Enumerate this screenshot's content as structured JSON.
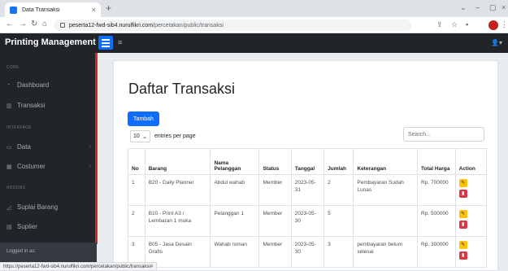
{
  "browser": {
    "tab_title": "Data Transaksi",
    "tab_close": "×",
    "new_tab": "+",
    "url_host": "peserta12-fwd-sib4.nurulfikri.com",
    "url_path": "/percetakan/public/transaksi",
    "status_url": "https://peserta12-fwd-sib4.nurulfikri.com/percetakan/public/transaksi#"
  },
  "topnav": {
    "brand": "Printing Management"
  },
  "sidebar": {
    "core_heading": "CORE",
    "dashboard": "Dashboard",
    "transaksi": "Transaksi",
    "interface_heading": "INTERFACE",
    "data": "Data",
    "costumer": "Costumer",
    "addons_heading": "ADDONS",
    "suplai": "Suplai Barang",
    "suplier": "Suplier",
    "footer_label": "Logged in as:"
  },
  "main": {
    "title": "Daftar Transaksi",
    "add_button": "Tambah",
    "page_length": "10",
    "entries_label": "entries per page",
    "search_placeholder": "Search...",
    "columns": [
      "No",
      "Barang",
      "Nama Pelanggan",
      "Status",
      "Tanggal",
      "Jumlah",
      "Keterangan",
      "Total Harga",
      "Action"
    ],
    "rows": [
      {
        "no": "1",
        "barang": "B20 - Daily Planner",
        "pelanggan": "Abdul wahab",
        "status": "Member",
        "tanggal": "2023-05-31",
        "jumlah": "2",
        "keterangan": "Pembayaran Sudah Lunas",
        "total": "Rp. 700000"
      },
      {
        "no": "2",
        "barang": "B10 - Print A3 / Lembaran 1 muka",
        "pelanggan": "Pelanggan 1",
        "status": "Member",
        "tanggal": "2023-05-30",
        "jumlah": "5",
        "keterangan": "",
        "total": "Rp. 500000"
      },
      {
        "no": "3",
        "barang": "B05 - Jasa Desain Grafis",
        "pelanggan": "Wahab roman",
        "status": "Member",
        "tanggal": "2023-05-30",
        "jumlah": "3",
        "keterangan": "pembayaran belum selesai",
        "total": "Rp. 300000"
      }
    ]
  },
  "colors": {
    "accent": "#0d6efd",
    "edit": "#ffc107",
    "delete": "#dc3545",
    "sidebar": "#212529"
  }
}
